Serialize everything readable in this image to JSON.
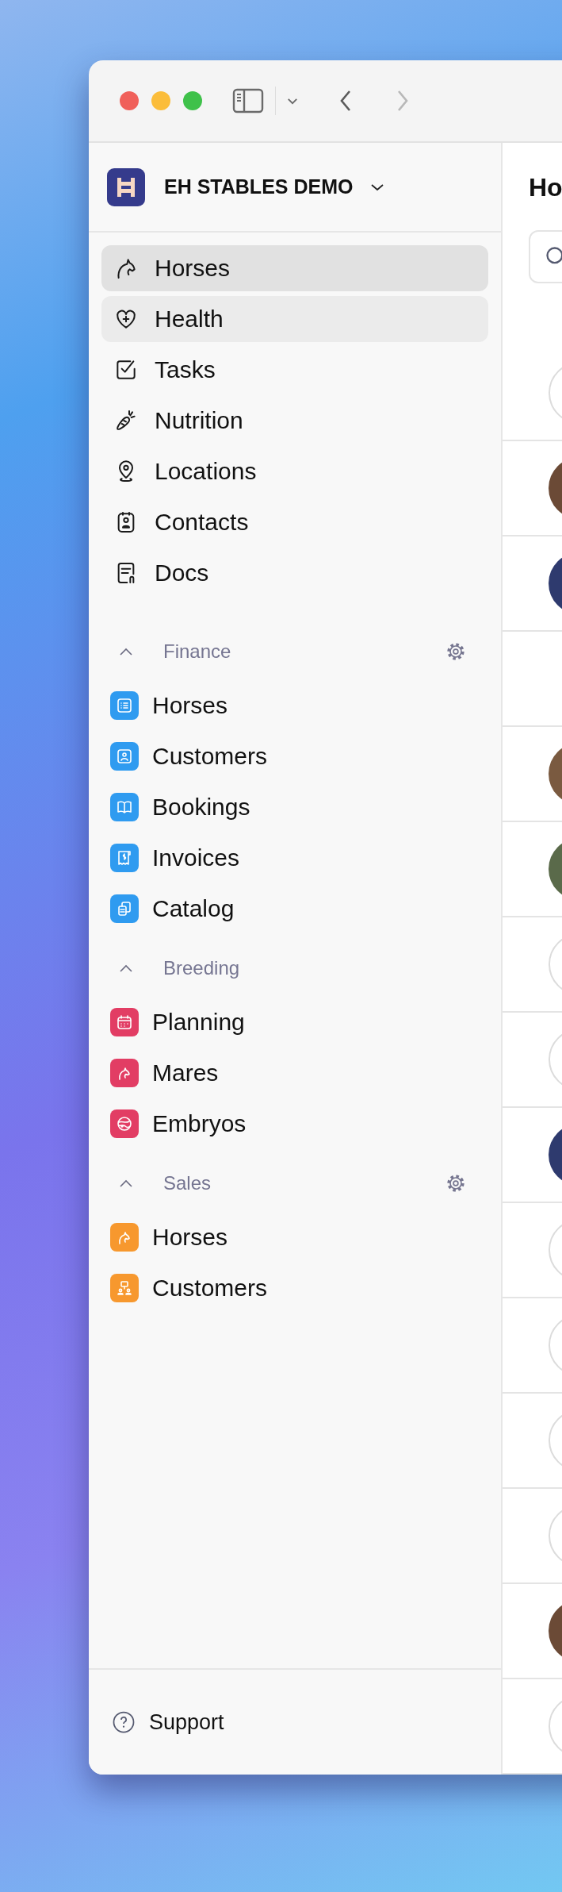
{
  "toolbar": {
    "back": {
      "disabled": false
    },
    "forward": {
      "disabled": true
    }
  },
  "sidebar": {
    "workspace": {
      "name": "EH STABLES DEMO"
    },
    "nav": [
      {
        "kind": "horse",
        "label": "Horses",
        "selected": true,
        "hovered": false
      },
      {
        "kind": "health",
        "label": "Health",
        "selected": false,
        "hovered": true
      },
      {
        "kind": "tasks",
        "label": "Tasks",
        "selected": false,
        "hovered": false
      },
      {
        "kind": "nutrition",
        "label": "Nutrition",
        "selected": false,
        "hovered": false
      },
      {
        "kind": "location",
        "label": "Locations",
        "selected": false,
        "hovered": false
      },
      {
        "kind": "contact",
        "label": "Contacts",
        "selected": false,
        "hovered": false
      },
      {
        "kind": "docs",
        "label": "Docs",
        "selected": false,
        "hovered": false
      }
    ],
    "sections": [
      {
        "title": "Finance",
        "expanded": true,
        "settings": true,
        "color": "#2f9bf0",
        "items": [
          {
            "kind": "list",
            "label": "Horses"
          },
          {
            "kind": "person",
            "label": "Customers"
          },
          {
            "kind": "book",
            "label": "Bookings"
          },
          {
            "kind": "receipt",
            "label": "Invoices"
          },
          {
            "kind": "copy",
            "label": "Catalog"
          }
        ]
      },
      {
        "title": "Breeding",
        "expanded": true,
        "settings": false,
        "color": "#e23d64",
        "items": [
          {
            "kind": "calendar",
            "label": "Planning"
          },
          {
            "kind": "horse",
            "label": "Mares"
          },
          {
            "kind": "embryo",
            "label": "Embryos"
          }
        ]
      },
      {
        "title": "Sales",
        "expanded": true,
        "settings": true,
        "color": "#f7982e",
        "items": [
          {
            "kind": "horse",
            "label": "Horses"
          },
          {
            "kind": "people",
            "label": "Customers"
          }
        ]
      }
    ],
    "support": {
      "label": "Support"
    }
  },
  "main": {
    "title": "Ho",
    "rows": [
      {
        "kind": "placeholder"
      },
      {
        "kind": "photo"
      },
      {
        "kind": "photo"
      },
      {
        "kind": "none"
      },
      {
        "kind": "photo"
      },
      {
        "kind": "photo"
      },
      {
        "kind": "placeholder"
      },
      {
        "kind": "placeholder"
      },
      {
        "kind": "photo"
      },
      {
        "kind": "placeholder"
      },
      {
        "kind": "placeholder"
      },
      {
        "kind": "placeholder"
      },
      {
        "kind": "placeholder"
      },
      {
        "kind": "photo"
      },
      {
        "kind": "placeholder"
      }
    ]
  }
}
